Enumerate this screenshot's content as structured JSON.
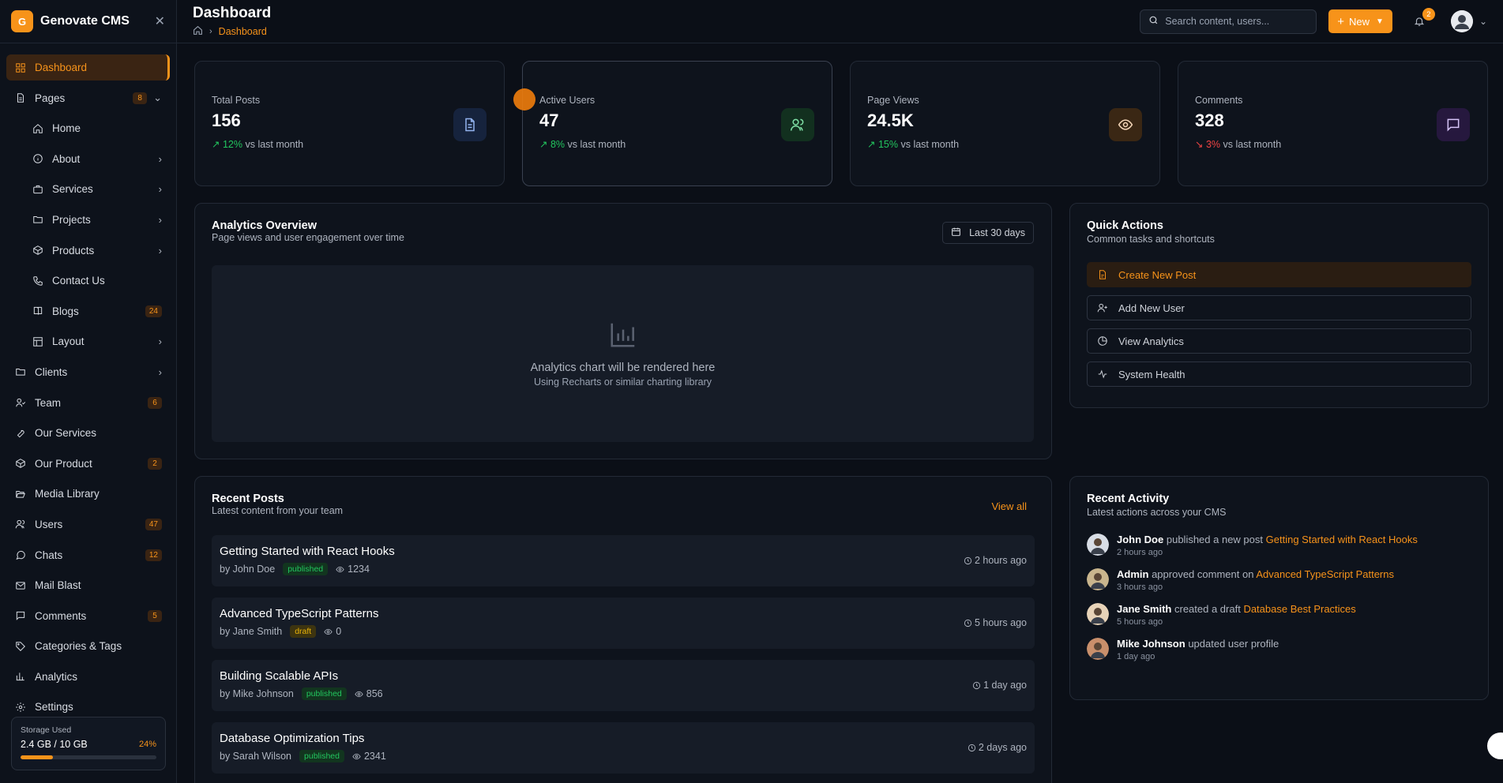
{
  "brand": {
    "logo": "G",
    "name": "Genovate CMS"
  },
  "sidebar": {
    "items": [
      {
        "label": "Dashboard",
        "icon": "dashboard-icon",
        "badge": "",
        "chevron": false,
        "sub": false,
        "active": true
      },
      {
        "label": "Pages",
        "icon": "file-icon",
        "badge": "8",
        "chevron": "down",
        "sub": false
      },
      {
        "label": "Home",
        "icon": "home-icon",
        "badge": "",
        "chevron": false,
        "sub": true
      },
      {
        "label": "About",
        "icon": "info-icon",
        "badge": "",
        "chevron": "right",
        "sub": true
      },
      {
        "label": "Services",
        "icon": "briefcase-icon",
        "badge": "",
        "chevron": "right",
        "sub": true
      },
      {
        "label": "Projects",
        "icon": "folder-icon",
        "badge": "",
        "chevron": "right",
        "sub": true
      },
      {
        "label": "Products",
        "icon": "box-icon",
        "badge": "",
        "chevron": "right",
        "sub": true
      },
      {
        "label": "Contact Us",
        "icon": "phone-icon",
        "badge": "",
        "chevron": false,
        "sub": true
      },
      {
        "label": "Blogs",
        "icon": "book-icon",
        "badge": "24",
        "chevron": false,
        "sub": true
      },
      {
        "label": "Layout",
        "icon": "layout-icon",
        "badge": "",
        "chevron": "right",
        "sub": true
      },
      {
        "label": "Clients",
        "icon": "folder-icon",
        "badge": "",
        "chevron": "right",
        "sub": false
      },
      {
        "label": "Team",
        "icon": "team-icon",
        "badge": "6",
        "chevron": false,
        "sub": false
      },
      {
        "label": "Our Services",
        "icon": "wrench-icon",
        "badge": "",
        "chevron": false,
        "sub": false
      },
      {
        "label": "Our Product",
        "icon": "box-icon",
        "badge": "2",
        "chevron": false,
        "sub": false
      },
      {
        "label": "Media Library",
        "icon": "folder-open-icon",
        "badge": "",
        "chevron": false,
        "sub": false
      },
      {
        "label": "Users",
        "icon": "users-icon",
        "badge": "47",
        "chevron": false,
        "sub": false
      },
      {
        "label": "Chats",
        "icon": "chat-icon",
        "badge": "12",
        "chevron": false,
        "sub": false
      },
      {
        "label": "Mail Blast",
        "icon": "mail-icon",
        "badge": "",
        "chevron": false,
        "sub": false
      },
      {
        "label": "Comments",
        "icon": "comment-icon",
        "badge": "5",
        "chevron": false,
        "sub": false
      },
      {
        "label": "Categories & Tags",
        "icon": "tag-icon",
        "badge": "",
        "chevron": false,
        "sub": false
      },
      {
        "label": "Analytics",
        "icon": "bar-chart-icon",
        "badge": "",
        "chevron": false,
        "sub": false
      },
      {
        "label": "Settings",
        "icon": "gear-icon",
        "badge": "",
        "chevron": false,
        "sub": false
      }
    ],
    "storage": {
      "label": "Storage Used",
      "value": "2.4 GB / 10 GB",
      "percent": "24%",
      "fraction": 0.24
    }
  },
  "header": {
    "title": "Dashboard",
    "breadcrumb": "Dashboard",
    "search_placeholder": "Search content, users...",
    "new_label": "New",
    "notif_count": "2"
  },
  "stats": [
    {
      "label": "Total Posts",
      "value": "156",
      "trend": "12%",
      "trend_dir": "up",
      "trend_text": "vs last month",
      "icon": "document-icon",
      "icon_bg": "#16233d",
      "icon_color": "#93b4f0"
    },
    {
      "label": "Active Users",
      "value": "47",
      "trend": "8%",
      "trend_dir": "up",
      "trend_text": "vs last month",
      "icon": "users-icon",
      "icon_bg": "#12301f",
      "icon_color": "#7fe0a6"
    },
    {
      "label": "Page Views",
      "value": "24.5K",
      "trend": "15%",
      "trend_dir": "up",
      "trend_text": "vs last month",
      "icon": "eye-icon",
      "icon_bg": "#3a2714",
      "icon_color": "#f5d7b8"
    },
    {
      "label": "Comments",
      "value": "328",
      "trend": "3%",
      "trend_dir": "down",
      "trend_text": "vs last month",
      "icon": "message-icon",
      "icon_bg": "#26183e",
      "icon_color": "#d6c4f7"
    }
  ],
  "analytics": {
    "title": "Analytics Overview",
    "subtitle": "Page views and user engagement over time",
    "range": "Last 30 days",
    "placeholder_title": "Analytics chart will be rendered here",
    "placeholder_sub": "Using Recharts or similar charting library"
  },
  "quick": {
    "title": "Quick Actions",
    "subtitle": "Common tasks and shortcuts",
    "actions": [
      {
        "label": "Create New Post",
        "icon": "file-plus-icon",
        "primary": true
      },
      {
        "label": "Add New User",
        "icon": "user-plus-icon",
        "primary": false
      },
      {
        "label": "View Analytics",
        "icon": "pie-chart-icon",
        "primary": false
      },
      {
        "label": "System Health",
        "icon": "activity-icon",
        "primary": false
      }
    ]
  },
  "posts": {
    "title": "Recent Posts",
    "subtitle": "Latest content from your team",
    "view_all": "View all",
    "items": [
      {
        "title": "Getting Started with React Hooks",
        "author": "by John Doe",
        "status": "published",
        "views": "1234",
        "time": "2 hours ago"
      },
      {
        "title": "Advanced TypeScript Patterns",
        "author": "by Jane Smith",
        "status": "draft",
        "views": "0",
        "time": "5 hours ago"
      },
      {
        "title": "Building Scalable APIs",
        "author": "by Mike Johnson",
        "status": "published",
        "views": "856",
        "time": "1 day ago"
      },
      {
        "title": "Database Optimization Tips",
        "author": "by Sarah Wilson",
        "status": "published",
        "views": "2341",
        "time": "2 days ago"
      }
    ]
  },
  "activity": {
    "title": "Recent Activity",
    "subtitle": "Latest actions across your CMS",
    "items": [
      {
        "user": "John Doe",
        "action": "published a new post",
        "target": "Getting Started with React Hooks",
        "time": "2 hours ago",
        "avatar_color": "#d8dde5"
      },
      {
        "user": "Admin",
        "action": "approved comment on",
        "target": "Advanced TypeScript Patterns",
        "time": "3 hours ago",
        "avatar_color": "#c9b58d"
      },
      {
        "user": "Jane Smith",
        "action": "created a draft",
        "target": "Database Best Practices",
        "time": "5 hours ago",
        "avatar_color": "#e7d3b8"
      },
      {
        "user": "Mike Johnson",
        "action": "updated user profile",
        "target": "",
        "time": "1 day ago",
        "avatar_color": "#c98f6b"
      }
    ]
  }
}
